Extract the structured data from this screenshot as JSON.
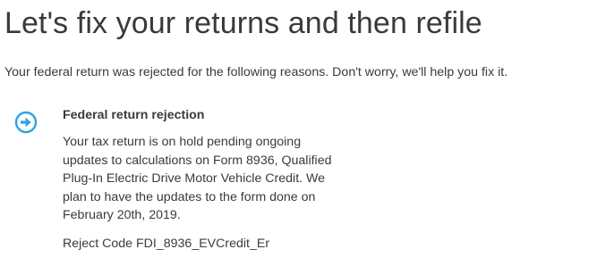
{
  "header": {
    "title": "Let's fix your returns and then refile"
  },
  "intro": {
    "text": "Your federal return was rejected for the following reasons. Don't worry, we'll help you fix it."
  },
  "rejection": {
    "icon": "arrow-right-circle-icon",
    "icon_color": "#2ca5e0",
    "title": "Federal return rejection",
    "message_lines": [
      "Your tax return is on hold pending ongoing",
      "updates to calculations on Form 8936, Qualified",
      "Plug-In Electric Drive Motor Vehicle Credit. We",
      "plan to have the updates to the form done on",
      "February 20th, 2019."
    ],
    "reject_code": "Reject Code FDI_8936_EVCredit_Er"
  },
  "colors": {
    "text": "#393a3d",
    "accent": "#2ca5e0"
  }
}
